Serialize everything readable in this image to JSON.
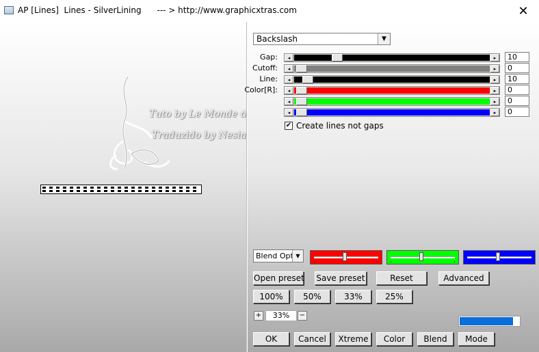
{
  "window": {
    "title": "AP [Lines]  Lines - SilverLining      --- > http://www.graphicxtras.com",
    "close_glyph": "✕",
    "icon": "window-app-icon"
  },
  "watermark": {
    "line1": "Tuto by Le Monde de Bea",
    "line2": "Traduzido by Nesia Navasc"
  },
  "mode_select": {
    "value": "Backslash",
    "arrow": "▼"
  },
  "sliders": [
    {
      "label": "Gap:",
      "value": "10",
      "track_color": "#000000",
      "thumb_pos": 0.22
    },
    {
      "label": "Cutoff:",
      "value": "0",
      "track_color": "#808080",
      "thumb_pos": 0.04
    },
    {
      "label": "Line:",
      "value": "10",
      "track_color": "#000000",
      "thumb_pos": 0.07
    },
    {
      "label": "Color[R]:",
      "value": "0",
      "track_color": "#ff0000",
      "thumb_pos": 0.04
    },
    {
      "label": "",
      "value": "0",
      "track_color": "#00ff00",
      "thumb_pos": 0.04
    },
    {
      "label": "",
      "value": "0",
      "track_color": "#0000ff",
      "thumb_pos": 0.04
    }
  ],
  "arrows": {
    "left": "◂",
    "right": "▸"
  },
  "checkbox": {
    "label": "Create lines not gaps",
    "checked": true,
    "mark": "✔"
  },
  "blend_select": {
    "value": "Blend Optio",
    "arrow": "▼"
  },
  "blend_sliders": [
    {
      "color": "#ff0000",
      "knob": 0.5
    },
    {
      "color": "#00ff00",
      "knob": 0.5
    },
    {
      "color": "#0000ff",
      "knob": 0.5
    }
  ],
  "buttons": {
    "open_preset": "Open preset",
    "save_preset": "Save preset",
    "reset": "Reset",
    "advanced": "Advanced",
    "z100": "100%",
    "z50": "50%",
    "z33": "33%",
    "z25": "25%",
    "ok": "OK",
    "cancel": "Cancel",
    "xtreme": "Xtreme",
    "color": "Color",
    "blend": "Blend",
    "mode": "Mode"
  },
  "zoom": {
    "plus": "+",
    "minus": "−",
    "value": "33%"
  },
  "progress": {
    "fraction": 0.9,
    "color": "#0a6fd8"
  }
}
